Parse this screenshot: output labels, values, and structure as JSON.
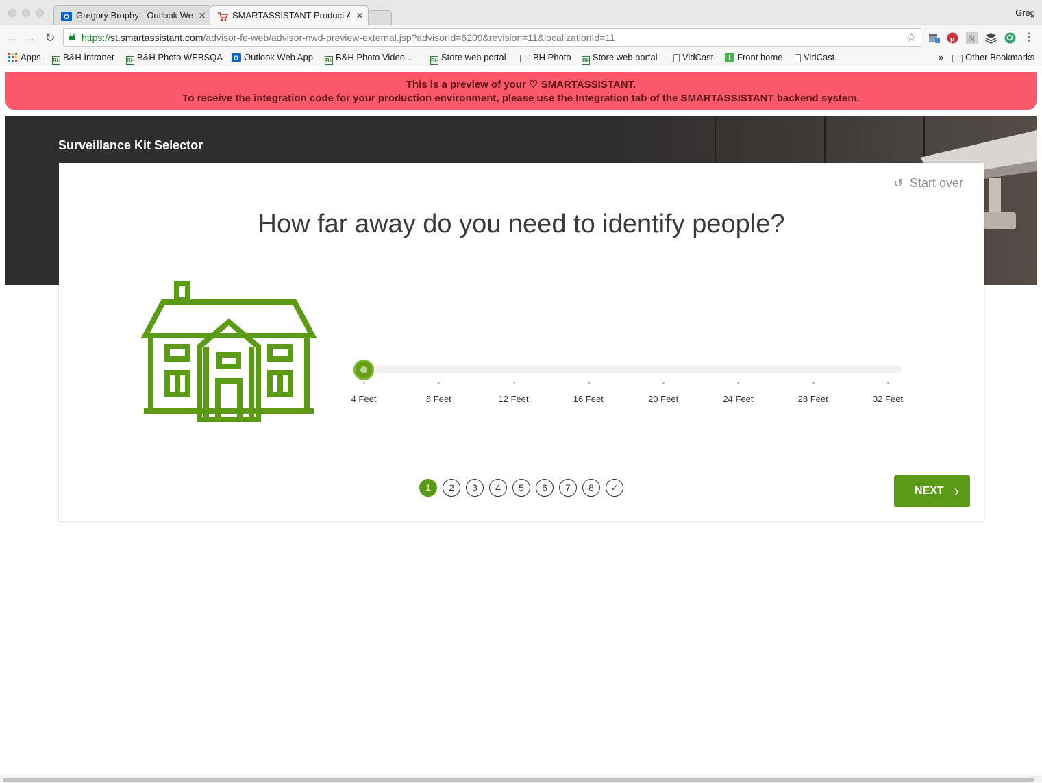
{
  "browser": {
    "tabs": [
      {
        "title": "Gregory Brophy - Outlook Web App",
        "icon": "outlook-icon",
        "active": false
      },
      {
        "title": "SMARTASSISTANT Product Advisor",
        "icon": "cart-icon",
        "active": true
      }
    ],
    "profile_name": "Greg",
    "url_scheme": "https://",
    "url_host": "st.smartassistant.com",
    "url_path": "/advisor-fe-web/advisor-nwd-preview-external.jsp?advisorId=6209&revision=11&localizationId=11",
    "bookmarks": [
      {
        "label": "Apps",
        "icon": "apps-grid-icon"
      },
      {
        "label": "B&H Intranet",
        "icon": "bh-icon"
      },
      {
        "label": "B&H Photo WEBSQA",
        "icon": "bh-icon"
      },
      {
        "label": "Outlook Web App",
        "icon": "outlook-icon"
      },
      {
        "label": "B&H Photo Video...",
        "icon": "bh-icon"
      },
      {
        "label": "Store web portal",
        "icon": "bh-icon"
      },
      {
        "label": "BH Photo",
        "icon": "folder-icon"
      },
      {
        "label": "Store web portal",
        "icon": "bh-icon"
      },
      {
        "label": "VidCast",
        "icon": "page-icon"
      },
      {
        "label": "Front home",
        "icon": "green-badge-icon"
      },
      {
        "label": "VidCast",
        "icon": "page-icon"
      }
    ],
    "bookmarks_overflow": "»",
    "other_bookmarks": "Other Bookmarks"
  },
  "banner": {
    "line1": "This is a preview of your ♡ SMARTASSISTANT.",
    "line2": "To receive the integration code for your production environment, please use the Integration tab of the SMARTASSISTANT backend system.",
    "color": "#fb5869"
  },
  "hero": {
    "title": "Surveillance Kit Selector"
  },
  "card": {
    "start_over": "Start over",
    "question": "How far away do you need to identify people?",
    "image_icon": "house-icon",
    "slider": {
      "options": [
        "4 Feet",
        "8 Feet",
        "12 Feet",
        "16 Feet",
        "20 Feet",
        "24 Feet",
        "28 Feet",
        "32 Feet"
      ],
      "selected_index": 0
    },
    "steps": [
      "1",
      "2",
      "3",
      "4",
      "5",
      "6",
      "7",
      "8"
    ],
    "current_step": 1,
    "final_step_icon": "checkmark-icon",
    "next_label": "NEXT",
    "accent": "#5b9a14"
  }
}
